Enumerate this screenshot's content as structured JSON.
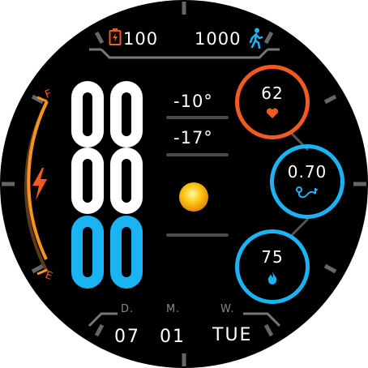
{
  "status_bar": {
    "battery_value": "100",
    "steps_value": "1000"
  },
  "battery_gauge": {
    "full_label": "F",
    "empty_label": "E",
    "level": 0.85
  },
  "time": {
    "hour_tens": "8",
    "hour_ones": "8",
    "minute_tens": "0",
    "minute_ones": "0"
  },
  "weather": {
    "temp_high": "-10°",
    "temp_low": "-17°",
    "icon": "sun-icon"
  },
  "metrics": {
    "heart_rate": "62",
    "distance": "0.70",
    "calories": "75"
  },
  "date": {
    "day_label": "D.",
    "month_label": "M.",
    "weekday_label": "W.",
    "day": "07",
    "month": "01",
    "weekday": "TUE"
  },
  "colors": {
    "orange": "#f15a22",
    "blue": "#1cb3f2",
    "gauge_orange": "#f7931e",
    "bolt": "#f15a22"
  }
}
